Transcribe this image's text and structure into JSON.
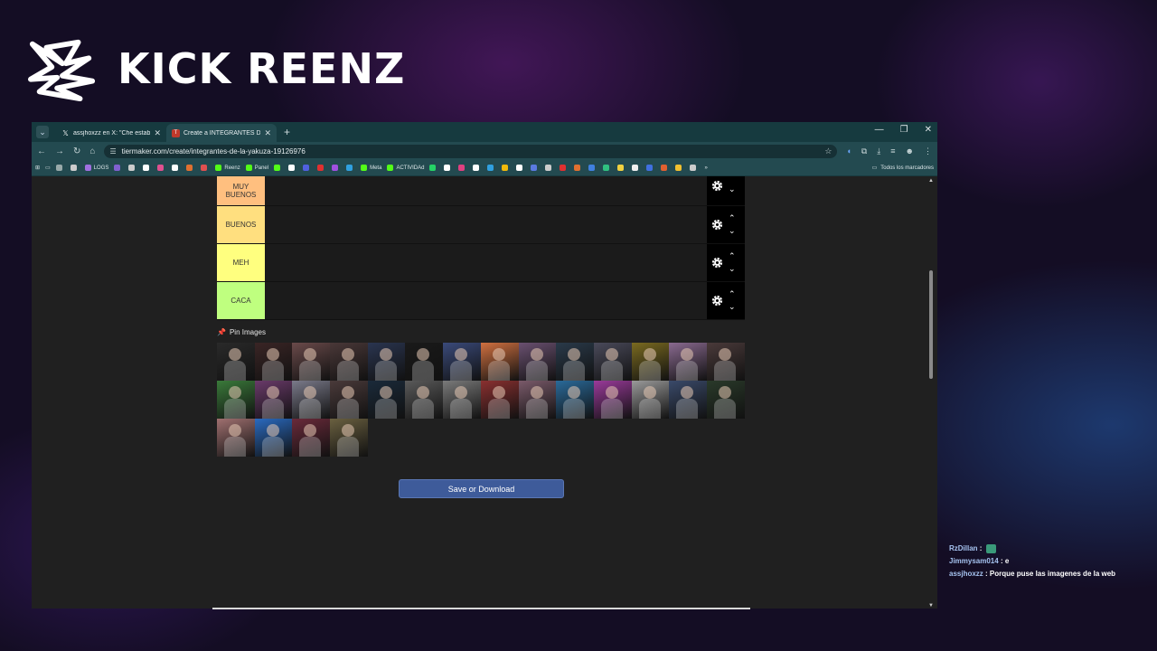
{
  "brand": {
    "name": "KICK REENZ"
  },
  "browser": {
    "tabs": [
      {
        "title": "assjhoxzz en X: \"Che estaba al ...",
        "icon": "x-icon",
        "active": false
      },
      {
        "title": "Create a INTEGRANTES DE LA ...",
        "icon": "tiermaker-icon",
        "active": true
      }
    ],
    "new_tab": "+",
    "url": "tiermaker.com/create/integrantes-de-la-yakuza-19126976",
    "bookmarks": [
      {
        "label": "",
        "color": "#9aa"
      },
      {
        "label": "",
        "color": "#ccc"
      },
      {
        "label": "LOGS",
        "color": "#a070e0"
      },
      {
        "label": "",
        "color": "#8060d0"
      },
      {
        "label": "",
        "color": "#ccc"
      },
      {
        "label": "",
        "color": "#fff"
      },
      {
        "label": "",
        "color": "#e05090"
      },
      {
        "label": "",
        "color": "#fff"
      },
      {
        "label": "",
        "color": "#e07030"
      },
      {
        "label": "",
        "color": "#e05050"
      },
      {
        "label": "Reenz",
        "color": "#53fc18"
      },
      {
        "label": "Panel",
        "color": "#53fc18"
      },
      {
        "label": "",
        "color": "#53fc18"
      },
      {
        "label": "",
        "color": "#fff"
      },
      {
        "label": "",
        "color": "#5060e0"
      },
      {
        "label": "",
        "color": "#e03030"
      },
      {
        "label": "",
        "color": "#a050e0"
      },
      {
        "label": "",
        "color": "#30a0e0"
      },
      {
        "label": "Meta",
        "color": "#53fc18"
      },
      {
        "label": "ACTIVIDAd",
        "color": "#53fc18"
      },
      {
        "label": "",
        "color": "#25d366"
      },
      {
        "label": "",
        "color": "#fff"
      },
      {
        "label": "",
        "color": "#e04080"
      },
      {
        "label": "",
        "color": "#fff"
      },
      {
        "label": "",
        "color": "#30a0e0"
      },
      {
        "label": "",
        "color": "#f0b90b"
      },
      {
        "label": "",
        "color": "#fff"
      },
      {
        "label": "",
        "color": "#5a7ae0"
      },
      {
        "label": "",
        "color": "#ccc"
      },
      {
        "label": "",
        "color": "#e03030"
      },
      {
        "label": "",
        "color": "#e07030"
      },
      {
        "label": "",
        "color": "#4080e0"
      },
      {
        "label": "",
        "color": "#30c080"
      },
      {
        "label": "",
        "color": "#f0d040"
      },
      {
        "label": "",
        "color": "#eee"
      },
      {
        "label": "",
        "color": "#4070e0"
      },
      {
        "label": "",
        "color": "#e06030"
      },
      {
        "label": "",
        "color": "#f0c030"
      },
      {
        "label": "",
        "color": "#ccc"
      }
    ],
    "bookmarks_overflow": "»",
    "all_bookmarks": "Todos los marcadores"
  },
  "tierlist": {
    "tiers": [
      {
        "label": "MUY BUENOS",
        "color": "#ffbf7f"
      },
      {
        "label": "BUENOS",
        "color": "#ffdf7f"
      },
      {
        "label": "MEH",
        "color": "#ffff7f"
      },
      {
        "label": "CACA",
        "color": "#bfff7f"
      }
    ],
    "pin_label": "Pin Images",
    "images": [
      "#2a2a2a",
      "#3a2525",
      "#6a4a4a",
      "#4a3838",
      "#2a3550",
      "#1a1a1a",
      "#3a4a7a",
      "#d07040",
      "#6a5070",
      "#2a3a4a",
      "#4a4a5a",
      "#7a6a20",
      "#8a6a90",
      "#4a3a3a",
      "#3a7a3a",
      "#6a3a6a",
      "#7a7a8a",
      "#4a3a3a",
      "#1a2a3a",
      "#5a5a5a",
      "#7a7a7a",
      "#8a3030",
      "#7a5a6a",
      "#2a6a9a",
      "#9a3a9a",
      "#9a9a9a",
      "#3a4a6a",
      "#2a3a2a",
      "#a07070",
      "#2a6ac0",
      "#6a2a3a",
      "#6a6040"
    ],
    "save_button": "Save or Download"
  },
  "chat": [
    {
      "user": "RzDillan",
      "sep": " : ",
      "message": "",
      "emote": true
    },
    {
      "user": "Jimmysam014",
      "sep": " : ",
      "message": "e",
      "emote": false
    },
    {
      "user": "assjhoxzz",
      "sep": " : ",
      "message": "Porque puse las imagenes de la web",
      "emote": false
    }
  ]
}
